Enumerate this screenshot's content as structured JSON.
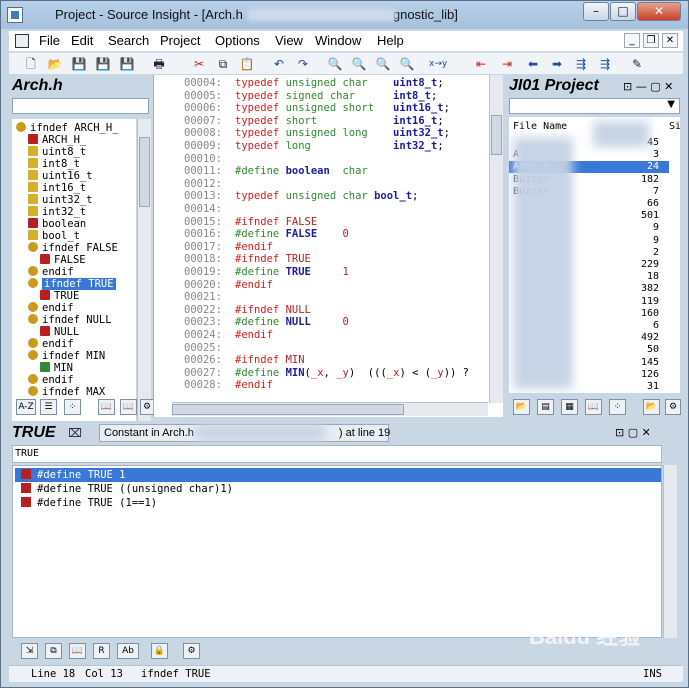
{
  "window": {
    "title": "Project - Source Insight - [Arch.h",
    "title_tail": "gnostic_lib]",
    "controls": {
      "minimize": "–",
      "maximize": "□",
      "close": "✕"
    }
  },
  "menu": [
    "File",
    "Edit",
    "Search",
    "Project",
    "Options",
    "View",
    "Window",
    "Help"
  ],
  "mdi_controls": {
    "minimize": "_",
    "restore": "❐",
    "close": "✕"
  },
  "symbol_window": {
    "title": "Arch.h",
    "items": [
      {
        "label": "ifndef ARCH_H_",
        "kind": "cond",
        "indent": 0
      },
      {
        "label": "ARCH_H_",
        "kind": "def",
        "indent": 1
      },
      {
        "label": "uint8_t",
        "kind": "type",
        "indent": 1
      },
      {
        "label": "int8_t",
        "kind": "type",
        "indent": 1
      },
      {
        "label": "uint16_t",
        "kind": "type",
        "indent": 1
      },
      {
        "label": "int16_t",
        "kind": "type",
        "indent": 1
      },
      {
        "label": "uint32_t",
        "kind": "type",
        "indent": 1
      },
      {
        "label": "int32_t",
        "kind": "type",
        "indent": 1
      },
      {
        "label": "boolean",
        "kind": "def",
        "indent": 1
      },
      {
        "label": "bool_t",
        "kind": "type",
        "indent": 1
      },
      {
        "label": "ifndef FALSE",
        "kind": "cond",
        "indent": 1
      },
      {
        "label": "FALSE",
        "kind": "def",
        "indent": 2
      },
      {
        "label": "endif",
        "kind": "cond",
        "indent": 1
      },
      {
        "label": "ifndef TRUE",
        "kind": "cond",
        "indent": 1,
        "selected": true
      },
      {
        "label": "TRUE",
        "kind": "def",
        "indent": 2
      },
      {
        "label": "endif",
        "kind": "cond",
        "indent": 1
      },
      {
        "label": "ifndef NULL",
        "kind": "cond",
        "indent": 1
      },
      {
        "label": "NULL",
        "kind": "def",
        "indent": 2
      },
      {
        "label": "endif",
        "kind": "cond",
        "indent": 1
      },
      {
        "label": "ifndef MIN",
        "kind": "cond",
        "indent": 1
      },
      {
        "label": "MIN",
        "kind": "macro",
        "indent": 2
      },
      {
        "label": "endif",
        "kind": "cond",
        "indent": 1
      },
      {
        "label": "ifndef MAX",
        "kind": "cond",
        "indent": 1
      }
    ],
    "sort_button": "A-Z"
  },
  "editor": {
    "lines": [
      {
        "no": "00004:",
        "parts": [
          [
            "kw",
            "typedef "
          ],
          [
            "ty",
            "unsigned char    "
          ],
          [
            "id",
            "uint8_t"
          ],
          [
            "",
            "; "
          ]
        ]
      },
      {
        "no": "00005:",
        "parts": [
          [
            "kw",
            "typedef "
          ],
          [
            "ty",
            "signed char      "
          ],
          [
            "id",
            "int8_t"
          ],
          [
            "",
            "; "
          ]
        ]
      },
      {
        "no": "00006:",
        "parts": [
          [
            "kw",
            "typedef "
          ],
          [
            "ty",
            "unsigned short   "
          ],
          [
            "id",
            "uint16_t"
          ],
          [
            "",
            ";"
          ]
        ]
      },
      {
        "no": "00007:",
        "parts": [
          [
            "kw",
            "typedef "
          ],
          [
            "ty",
            "short            "
          ],
          [
            "id",
            "int16_t"
          ],
          [
            "",
            ";"
          ]
        ]
      },
      {
        "no": "00008:",
        "parts": [
          [
            "kw",
            "typedef "
          ],
          [
            "ty",
            "unsigned long    "
          ],
          [
            "id",
            "uint32_t"
          ],
          [
            "",
            ";"
          ]
        ]
      },
      {
        "no": "00009:",
        "parts": [
          [
            "kw",
            "typedef "
          ],
          [
            "ty",
            "long             "
          ],
          [
            "id",
            "int32_t"
          ],
          [
            "",
            ";"
          ]
        ]
      },
      {
        "no": "00010:",
        "parts": []
      },
      {
        "no": "00011:",
        "parts": [
          [
            "ty",
            "#define "
          ],
          [
            "id",
            "boolean"
          ],
          [
            "ty",
            "  char"
          ]
        ]
      },
      {
        "no": "00012:",
        "parts": []
      },
      {
        "no": "00013:",
        "parts": [
          [
            "kw",
            "typedef "
          ],
          [
            "ty",
            "unsigned char "
          ],
          [
            "id",
            "bool_t"
          ],
          [
            "",
            ";"
          ]
        ]
      },
      {
        "no": "00014:",
        "parts": []
      },
      {
        "no": "00015:",
        "parts": [
          [
            "pp",
            "#ifndef "
          ],
          [
            "nm",
            "FALSE"
          ]
        ]
      },
      {
        "no": "00016:",
        "parts": [
          [
            "ty",
            "#define "
          ],
          [
            "id",
            "FALSE"
          ],
          [
            "nm",
            "    0"
          ]
        ]
      },
      {
        "no": "00017:",
        "parts": [
          [
            "pp",
            "#endif"
          ]
        ]
      },
      {
        "no": "00018:",
        "parts": [
          [
            "pp",
            "#ifndef "
          ],
          [
            "nm",
            "TRUE"
          ]
        ]
      },
      {
        "no": "00019:",
        "parts": [
          [
            "ty",
            "#define "
          ],
          [
            "id",
            "TRUE"
          ],
          [
            "nm",
            "     1"
          ]
        ]
      },
      {
        "no": "00020:",
        "parts": [
          [
            "pp",
            "#endif"
          ]
        ]
      },
      {
        "no": "00021:",
        "parts": []
      },
      {
        "no": "00022:",
        "parts": [
          [
            "pp",
            "#ifndef "
          ],
          [
            "nm",
            "NULL"
          ]
        ]
      },
      {
        "no": "00023:",
        "parts": [
          [
            "ty",
            "#define "
          ],
          [
            "id",
            "NULL"
          ],
          [
            "nm",
            "     0"
          ]
        ]
      },
      {
        "no": "00024:",
        "parts": [
          [
            "pp",
            "#endif"
          ]
        ]
      },
      {
        "no": "00025:",
        "parts": []
      },
      {
        "no": "00026:",
        "parts": [
          [
            "pp",
            "#ifndef "
          ],
          [
            "nm",
            "MIN"
          ]
        ]
      },
      {
        "no": "00027:",
        "parts": [
          [
            "ty",
            "#define "
          ],
          [
            "id",
            "MIN"
          ],
          [
            "",
            "("
          ],
          [
            "nm",
            "_x"
          ],
          [
            ",",
            ", "
          ],
          [
            "nm",
            "_y"
          ],
          [
            "",
            ")  ((("
          ],
          [
            "nm",
            "_x"
          ],
          [
            "",
            ") < ("
          ],
          [
            "nm",
            "_y"
          ],
          [
            "",
            ")) ?"
          ]
        ]
      },
      {
        "no": "00028:",
        "parts": [
          [
            "pp",
            "#endif"
          ]
        ]
      }
    ]
  },
  "project_window": {
    "title": "JI01 Project",
    "header": {
      "name": "File Name",
      "size": "Si"
    },
    "files": [
      {
        "name": "",
        "size": "45"
      },
      {
        "name": "A",
        "size": "3"
      },
      {
        "name": "Arch.h",
        "size": "24",
        "selected": true
      },
      {
        "name": "Buzzer",
        "size": "182"
      },
      {
        "name": "Buzzer",
        "size": "7"
      },
      {
        "name": "",
        "size": "66"
      },
      {
        "name": "",
        "size": "501"
      },
      {
        "name": "",
        "size": "9"
      },
      {
        "name": "",
        "size": "9"
      },
      {
        "name": "",
        "size": "2"
      },
      {
        "name": "",
        "size": "229"
      },
      {
        "name": "",
        "size": "18"
      },
      {
        "name": "",
        "size": "382"
      },
      {
        "name": "",
        "size": "119"
      },
      {
        "name": "",
        "size": "160"
      },
      {
        "name": "",
        "size": "6"
      },
      {
        "name": "",
        "size": "492"
      },
      {
        "name": "",
        "size": "50"
      },
      {
        "name": "",
        "size": "145"
      },
      {
        "name": "",
        "size": "126"
      },
      {
        "name": "",
        "size": "31"
      }
    ]
  },
  "context_window": {
    "title": "TRUE",
    "info_prefix": "Constant in Arch.h",
    "info_suffix": ") at line 19",
    "symbol_field": "TRUE",
    "rows": [
      {
        "text": "#define TRUE 1",
        "selected": true
      },
      {
        "text": "#define TRUE ((unsigned char)1)"
      },
      {
        "text": "#define TRUE (1==1)"
      }
    ]
  },
  "status": {
    "line": "Line 18",
    "col": "Col 13",
    "context": "ifndef TRUE",
    "mode": "INS"
  },
  "watermark": "Baidu 经验"
}
